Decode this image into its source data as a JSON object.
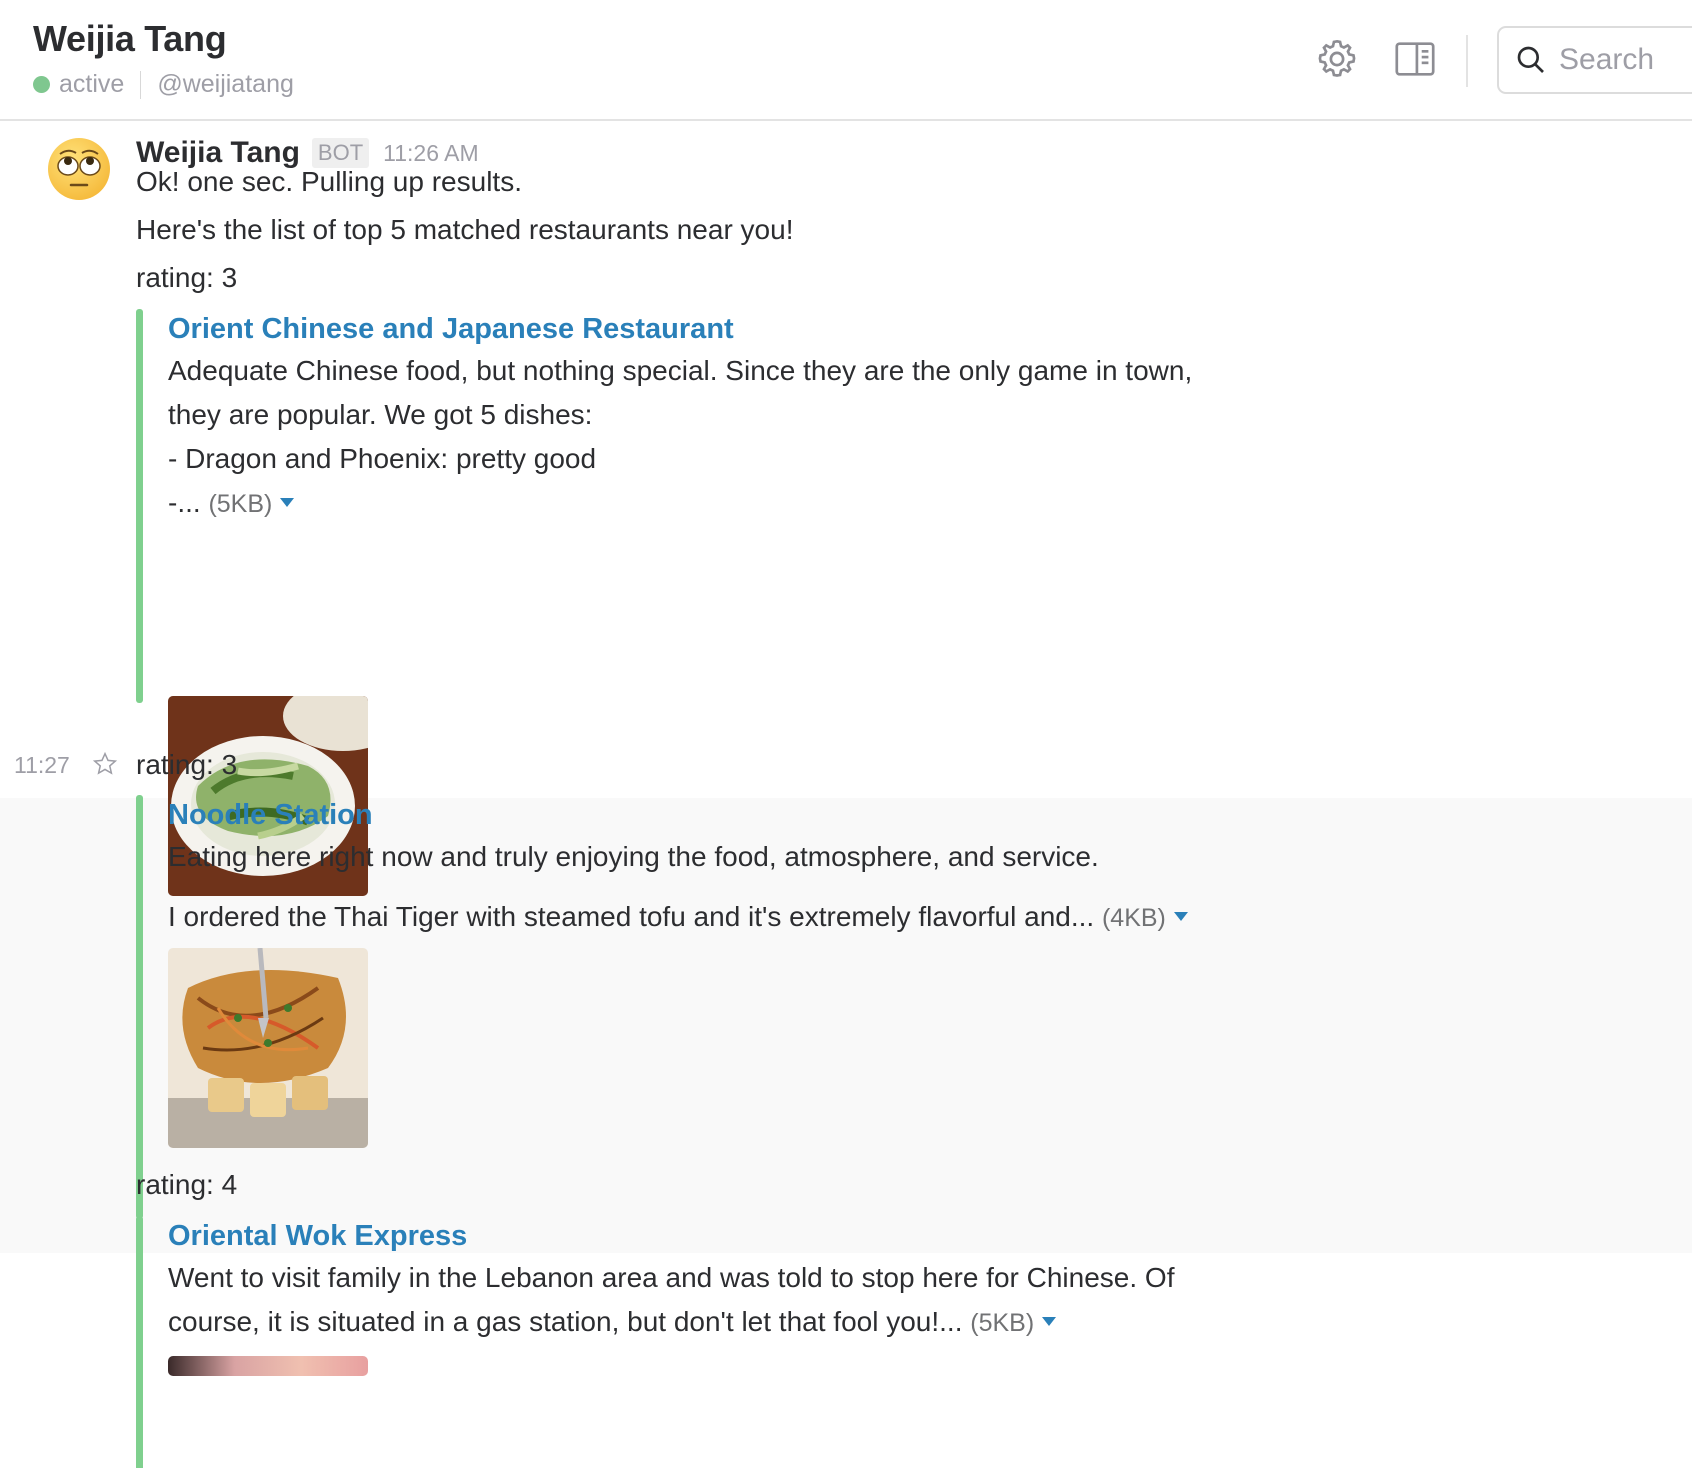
{
  "header": {
    "title": "Weijia Tang",
    "status": "active",
    "handle": "@weijiatang",
    "search_placeholder": "Search",
    "icons": [
      "gear-icon",
      "sidebar-panel-icon",
      "search-icon"
    ],
    "presence_color": "#7fc78f"
  },
  "message": {
    "sender": "Weijia Tang",
    "badge": "BOT",
    "time": "11:26 AM",
    "lines": [
      "Ok! one sec. Pulling up results.",
      "Here's the list of top 5 matched restaurants near you!"
    ]
  },
  "results": [
    {
      "rating": "rating: 3",
      "title": "Orient Chinese and Japanese Restaurant",
      "text_lines": [
        "Adequate Chinese food, but nothing special.  Since they are the only game in town,",
        "they are popular.  We got 5 dishes:",
        "- Dragon and Phoenix: pretty good",
        "-..."
      ],
      "size": "(5KB)",
      "image": "plate of stir-fried greens"
    },
    {
      "hover_time": "11:27",
      "rating": "rating: 3",
      "title": "Noodle Station",
      "text_lines": [
        "Eating here right now and truly enjoying the food, atmosphere, and service.",
        "I ordered the Thai Tiger with steamed tofu and it's extremely flavorful and..."
      ],
      "size": "(4KB)",
      "image": "noodles with tofu"
    },
    {
      "rating": "rating: 4",
      "title": "Oriental Wok Express",
      "text_lines": [
        "Went to visit family in the Lebanon area and was told to stop here for Chinese. Of",
        "course, it is situated in a gas station, but don't let that fool you!..."
      ],
      "size": "(5KB)"
    }
  ],
  "colors": {
    "link": "#2a80b9",
    "attachment_bar": "#7fd08e",
    "muted": "#9e9ea6"
  }
}
